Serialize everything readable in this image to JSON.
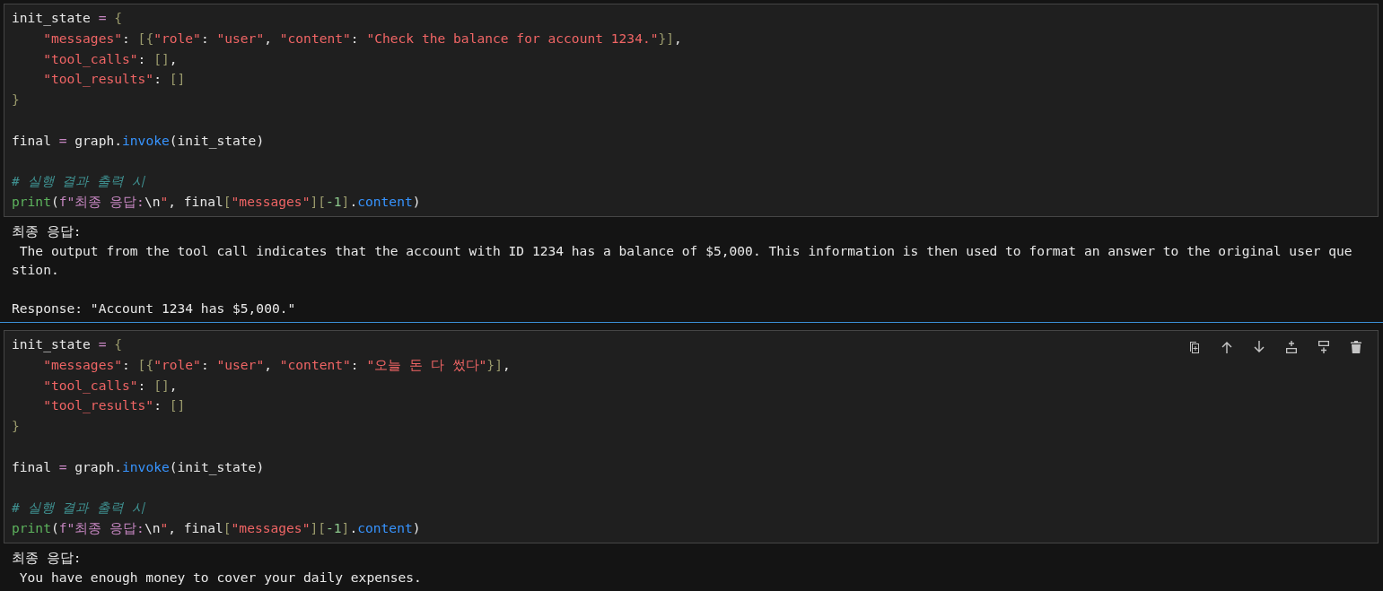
{
  "cells": [
    {
      "selected": false,
      "code": [
        {
          "tokens": [
            {
              "kind": "plain",
              "t": "init_state "
            },
            {
              "kind": "operator",
              "t": "="
            },
            {
              "kind": "bracket",
              "t": " {"
            }
          ]
        },
        {
          "indent": true,
          "tokens": [
            {
              "kind": "string",
              "t": "\"messages\""
            },
            {
              "kind": "plain",
              "t": ": "
            },
            {
              "kind": "bracket",
              "t": "[{"
            },
            {
              "kind": "string",
              "t": "\"role\""
            },
            {
              "kind": "plain",
              "t": ": "
            },
            {
              "kind": "string",
              "t": "\"user\""
            },
            {
              "kind": "plain",
              "t": ", "
            },
            {
              "kind": "string",
              "t": "\"content\""
            },
            {
              "kind": "plain",
              "t": ": "
            },
            {
              "kind": "string",
              "t": "\"Check the balance for account 1234.\""
            },
            {
              "kind": "bracket",
              "t": "}]"
            },
            {
              "kind": "plain",
              "t": ","
            }
          ]
        },
        {
          "indent": true,
          "tokens": [
            {
              "kind": "string",
              "t": "\"tool_calls\""
            },
            {
              "kind": "plain",
              "t": ": "
            },
            {
              "kind": "bracket",
              "t": "[]"
            },
            {
              "kind": "plain",
              "t": ","
            }
          ]
        },
        {
          "indent": true,
          "tokens": [
            {
              "kind": "string",
              "t": "\"tool_results\""
            },
            {
              "kind": "plain",
              "t": ": "
            },
            {
              "kind": "bracket",
              "t": "[]"
            }
          ]
        },
        {
          "gap_after": true,
          "tokens": [
            {
              "kind": "bracket",
              "t": "}"
            }
          ]
        },
        {
          "gap_after": true,
          "tokens": [
            {
              "kind": "plain",
              "t": "final "
            },
            {
              "kind": "operator",
              "t": "="
            },
            {
              "kind": "plain",
              "t": " graph."
            },
            {
              "kind": "function",
              "t": "invoke"
            },
            {
              "kind": "plain",
              "t": "(init_state)"
            }
          ]
        },
        {
          "tokens": [
            {
              "kind": "comment",
              "t": "# 실행 결과 출력 시"
            }
          ]
        },
        {
          "tokens": [
            {
              "kind": "builtin",
              "t": "print"
            },
            {
              "kind": "plain",
              "t": "("
            },
            {
              "kind": "operator",
              "t": "f\"최종 응답:"
            },
            {
              "kind": "plain",
              "t": "\\n"
            },
            {
              "kind": "string",
              "t": "\""
            },
            {
              "kind": "plain",
              "t": ", final"
            },
            {
              "kind": "bracket",
              "t": "["
            },
            {
              "kind": "string",
              "t": "\"messages\""
            },
            {
              "kind": "bracket",
              "t": "]["
            },
            {
              "kind": "number",
              "t": "-1"
            },
            {
              "kind": "bracket",
              "t": "]"
            },
            {
              "kind": "plain",
              "t": "."
            },
            {
              "kind": "function",
              "t": "content"
            },
            {
              "kind": "plain",
              "t": ")"
            }
          ]
        }
      ],
      "output": [
        [
          "최종 응답:",
          " The output from the tool call indicates that the account with ID 1234 has a balance of $5,000. This information is then used to format an answer to the original user que",
          "stion."
        ],
        [
          "Response: \"Account 1234 has $5,000.\""
        ]
      ]
    },
    {
      "selected": true,
      "code": [
        {
          "tokens": [
            {
              "kind": "plain",
              "t": "init_state "
            },
            {
              "kind": "operator",
              "t": "="
            },
            {
              "kind": "bracket",
              "t": " {"
            }
          ]
        },
        {
          "indent": true,
          "tokens": [
            {
              "kind": "string",
              "t": "\"messages\""
            },
            {
              "kind": "plain",
              "t": ": "
            },
            {
              "kind": "bracket",
              "t": "[{"
            },
            {
              "kind": "string",
              "t": "\"role\""
            },
            {
              "kind": "plain",
              "t": ": "
            },
            {
              "kind": "string",
              "t": "\"user\""
            },
            {
              "kind": "plain",
              "t": ", "
            },
            {
              "kind": "string",
              "t": "\"content\""
            },
            {
              "kind": "plain",
              "t": ": "
            },
            {
              "kind": "string",
              "t": "\"오늘 돈 다 썼다\""
            },
            {
              "kind": "bracket",
              "t": "}]"
            },
            {
              "kind": "plain",
              "t": ","
            }
          ]
        },
        {
          "indent": true,
          "tokens": [
            {
              "kind": "string",
              "t": "\"tool_calls\""
            },
            {
              "kind": "plain",
              "t": ": "
            },
            {
              "kind": "bracket",
              "t": "[]"
            },
            {
              "kind": "plain",
              "t": ","
            }
          ]
        },
        {
          "indent": true,
          "tokens": [
            {
              "kind": "string",
              "t": "\"tool_results\""
            },
            {
              "kind": "plain",
              "t": ": "
            },
            {
              "kind": "bracket",
              "t": "[]"
            }
          ]
        },
        {
          "gap_after": true,
          "tokens": [
            {
              "kind": "bracket",
              "t": "}"
            }
          ]
        },
        {
          "gap_after": true,
          "tokens": [
            {
              "kind": "plain",
              "t": "final "
            },
            {
              "kind": "operator",
              "t": "="
            },
            {
              "kind": "plain",
              "t": " graph."
            },
            {
              "kind": "function",
              "t": "invoke"
            },
            {
              "kind": "plain",
              "t": "(init_state)"
            }
          ]
        },
        {
          "tokens": [
            {
              "kind": "comment",
              "t": "# 실행 결과 출력 시"
            }
          ]
        },
        {
          "tokens": [
            {
              "kind": "builtin",
              "t": "print"
            },
            {
              "kind": "plain",
              "t": "("
            },
            {
              "kind": "operator",
              "t": "f\"최종 응답:"
            },
            {
              "kind": "plain",
              "t": "\\n"
            },
            {
              "kind": "string",
              "t": "\""
            },
            {
              "kind": "plain",
              "t": ", final"
            },
            {
              "kind": "bracket",
              "t": "["
            },
            {
              "kind": "string",
              "t": "\"messages\""
            },
            {
              "kind": "bracket",
              "t": "]["
            },
            {
              "kind": "number",
              "t": "-1"
            },
            {
              "kind": "bracket",
              "t": "]"
            },
            {
              "kind": "plain",
              "t": "."
            },
            {
              "kind": "function",
              "t": "content"
            },
            {
              "kind": "plain",
              "t": ")"
            }
          ]
        }
      ],
      "output": [
        [
          "최종 응답:",
          " You have enough money to cover your daily expenses."
        ]
      ]
    }
  ]
}
